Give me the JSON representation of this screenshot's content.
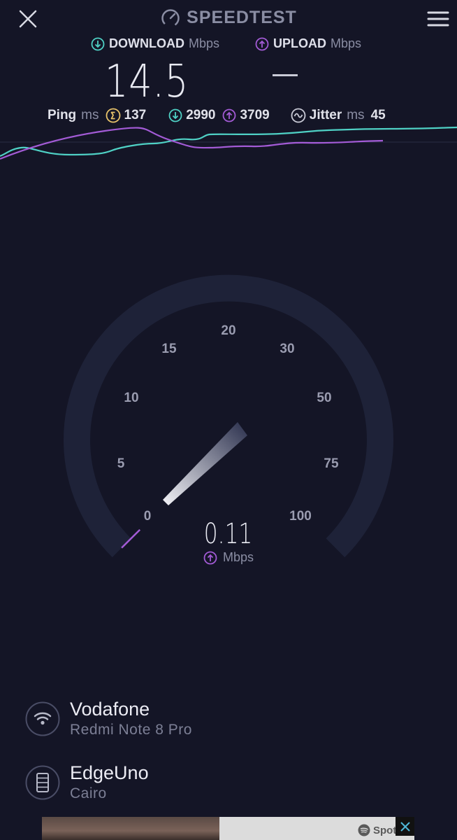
{
  "header": {
    "title": "SPEEDTEST"
  },
  "metrics": {
    "download": {
      "label": "DOWNLOAD",
      "unit": "Mbps",
      "value": "14.5"
    },
    "upload": {
      "label": "UPLOAD",
      "unit": "Mbps",
      "value": "—"
    }
  },
  "stats": {
    "ping_label": "Ping",
    "ping_unit": "ms",
    "ping_value": "137",
    "download_latency": "2990",
    "upload_latency": "3709",
    "jitter_label": "Jitter",
    "jitter_unit": "ms",
    "jitter_value": "45"
  },
  "gauge": {
    "ticks": [
      "0",
      "5",
      "10",
      "15",
      "20",
      "30",
      "50",
      "75",
      "100"
    ],
    "current_value": "0.11",
    "unit": "Mbps"
  },
  "connection": {
    "provider": "Vodafone",
    "device": "Redmi Note 8 Pro"
  },
  "server": {
    "name": "EdgeUno",
    "location": "Cairo"
  },
  "ad": {
    "brand": "Spotify"
  },
  "colors": {
    "background": "#141526",
    "download_accent": "#4fd1c5",
    "upload_accent": "#a35bd6",
    "ping_accent": "#e8c36a",
    "gauge_track": "#1e2238"
  }
}
